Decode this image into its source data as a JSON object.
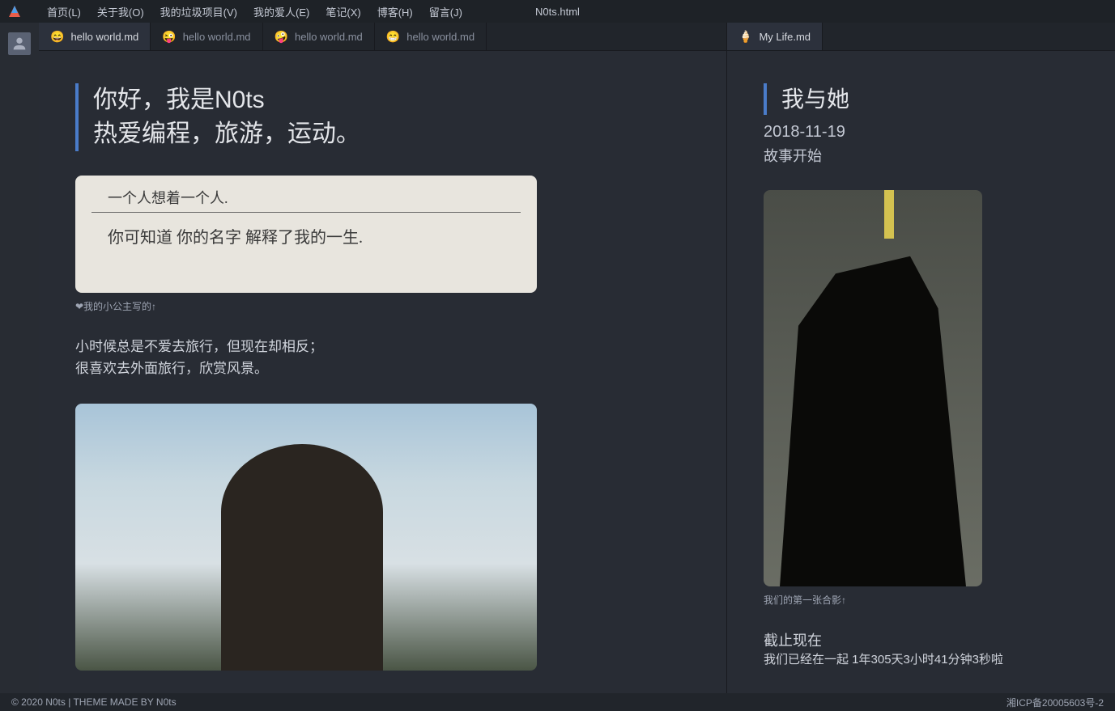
{
  "menubar": {
    "items": [
      "首页(L)",
      "关于我(O)",
      "我的垃圾项目(V)",
      "我的爱人(E)",
      "笔记(X)",
      "博客(H)",
      "留言(J)"
    ],
    "title": "N0ts.html"
  },
  "leftPanel": {
    "tabs": [
      {
        "emoji": "😄",
        "label": "hello world.md",
        "active": true
      },
      {
        "emoji": "😜",
        "label": "hello world.md",
        "active": false
      },
      {
        "emoji": "🤪",
        "label": "hello world.md",
        "active": false
      },
      {
        "emoji": "😁",
        "label": "hello world.md",
        "active": false
      }
    ],
    "heading_line1": "你好，我是N0ts",
    "heading_line2": "热爱编程，旅游，运动。",
    "note_line1": "一个人想着一个人.",
    "note_line2": "你可知道 你的名字 解释了我的一生.",
    "note_caption": "❤我的小公主写的↑",
    "travel_line1": "小时候总是不爱去旅行，但现在却相反；",
    "travel_line2": "很喜欢去外面旅行，欣赏风景。"
  },
  "rightPanel": {
    "tabs": [
      {
        "emoji": "🍦",
        "label": "My Life.md",
        "active": true
      }
    ],
    "heading": "我与她",
    "date": "2018-11-19",
    "subtitle": "故事开始",
    "photo_caption": "我们的第一张合影↑",
    "countdown_label": "截止现在",
    "countdown_text": "我们已经在一起 1年305天3小时41分钟3秒啦"
  },
  "footer": {
    "left": "© 2020 N0ts | THEME MADE BY N0ts",
    "right": "湘ICP备20005603号-2"
  }
}
